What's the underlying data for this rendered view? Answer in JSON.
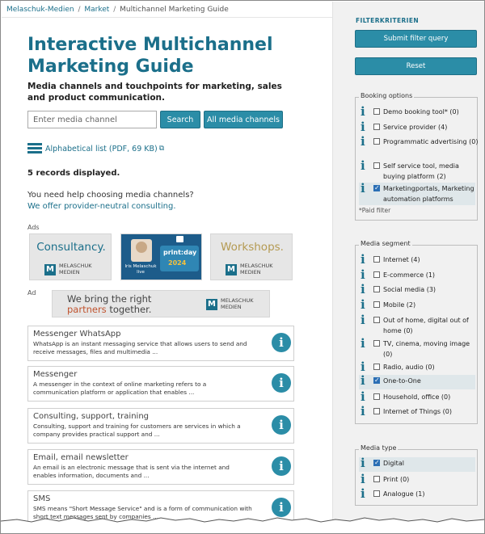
{
  "breadcrumb": {
    "items": [
      "Melaschuk-Medien",
      "Market",
      "Multichannel Marketing Guide"
    ]
  },
  "title": "Interactive Multichannel Marketing Guide",
  "subtitle": "Media channels and touchpoints for marketing, sales and product communication.",
  "search": {
    "placeholder": "Enter media channel",
    "search_label": "Search",
    "all_label": "All media channels"
  },
  "alpha_list": {
    "text": "Alphabetical list (PDF, 69 KB)"
  },
  "records": "5 records displayed.",
  "help": {
    "question": "You need help choosing media channels?",
    "link": "We offer provider-neutral consulting."
  },
  "ads": {
    "label": "Ads",
    "consultancy": "Consultancy.",
    "workshops": "Workshops.",
    "logo_line1": "MELASCHUK",
    "logo_line2": "MEDIEN",
    "printday": {
      "person_line1": "Iris Melaschuk",
      "person_line2": "live",
      "title": "print:day",
      "year": "2024"
    },
    "ad_label": "Ad",
    "banner_line1": "We bring the right",
    "banner_accent": "partners",
    "banner_rest": " together."
  },
  "cards": [
    {
      "title": "Messenger WhatsApp",
      "desc": "WhatsApp is an instant messaging service that allows users to send and receive messages, files and multimedia ..."
    },
    {
      "title": "Messenger",
      "desc": "A messenger in the context of online marketing refers to a communication platform or application that enables ..."
    },
    {
      "title": "Consulting, support, training",
      "desc": "Consulting, support and training for customers are services in which a company provides practical support and ..."
    },
    {
      "title": "Email, email newsletter",
      "desc": "An email is an electronic message that is sent via the internet and enables information, documents and ..."
    },
    {
      "title": "SMS",
      "desc": "SMS means \"Short Message Service\" and is a form of communication with short text messages sent by companies ..."
    }
  ],
  "sidebar": {
    "heading": "FILTERKRITERIEN",
    "submit_label": "Submit filter query",
    "reset_label": "Reset",
    "booking": {
      "legend": "Booking options",
      "items": [
        {
          "label": "Demo booking tool* (0)",
          "checked": false
        },
        {
          "label": "Service provider (4)",
          "checked": false
        },
        {
          "label": "Programmatic advertising (0)",
          "checked": false
        },
        {
          "label": "Self service tool, media buying platform (2)",
          "checked": false
        },
        {
          "label": "Marketingportals, Marketing automation platforms",
          "checked": true
        }
      ],
      "note": "*Paid filter"
    },
    "segment": {
      "legend": "Media segment",
      "items": [
        {
          "label": "Internet (4)",
          "checked": false
        },
        {
          "label": "E-commerce (1)",
          "checked": false
        },
        {
          "label": "Social media (3)",
          "checked": false
        },
        {
          "label": "Mobile (2)",
          "checked": false
        },
        {
          "label": "Out of home, digital out of home (0)",
          "checked": false
        },
        {
          "label": "TV, cinema, moving image (0)",
          "checked": false
        },
        {
          "label": "Radio, audio (0)",
          "checked": false
        },
        {
          "label": "One-to-One",
          "checked": true
        },
        {
          "label": "Household, office (0)",
          "checked": false
        },
        {
          "label": "Internet of Things (0)",
          "checked": false
        }
      ]
    },
    "type": {
      "legend": "Media type",
      "items": [
        {
          "label": "Digital",
          "checked": true
        },
        {
          "label": "Print (0)",
          "checked": false
        },
        {
          "label": "Analogue (1)",
          "checked": false
        }
      ]
    }
  },
  "colors": {
    "accent": "#1b6f8a",
    "button": "#2b8da7",
    "workshop_gold": "#b49a52",
    "banner_accent": "#c0532e"
  },
  "icons": [
    "list-icon",
    "external-link-icon",
    "info-icon",
    "checkbox-icon",
    "checkmark-icon"
  ]
}
